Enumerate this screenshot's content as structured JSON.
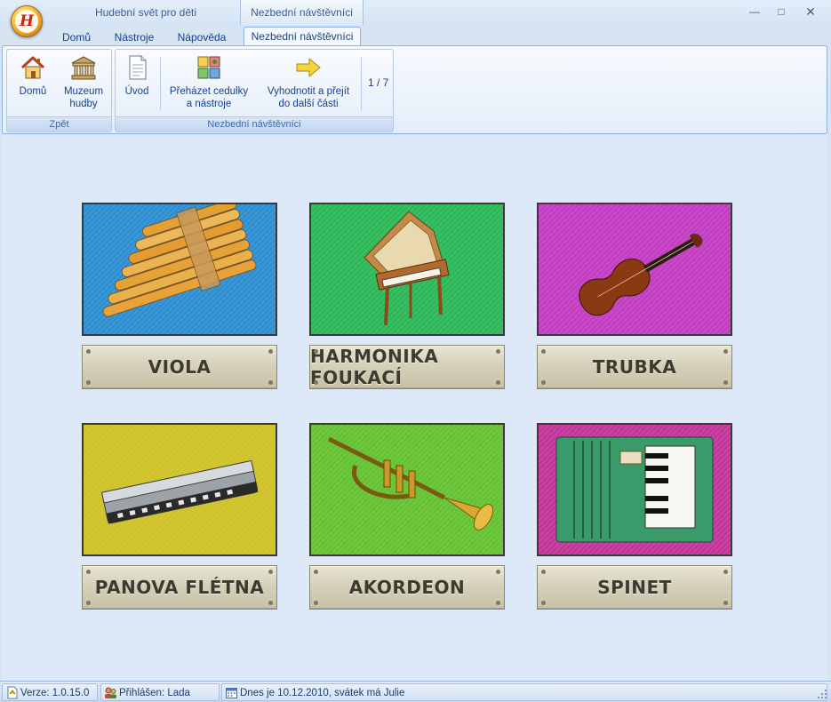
{
  "window": {
    "title_tab": "Hudební svět pro děti",
    "context_tab": "Nezbední návštěvníci",
    "buttons": [
      "minimize",
      "maximize",
      "close"
    ]
  },
  "ribbon_tabs": [
    {
      "label": "Domů"
    },
    {
      "label": "Nástroje"
    },
    {
      "label": "Nápověda"
    },
    {
      "label": "Nezbední návštěvníci",
      "active": true
    }
  ],
  "ribbon": {
    "groups": [
      {
        "caption": "Zpět",
        "buttons": [
          {
            "label": "Domů",
            "icon": "house-icon"
          },
          {
            "label": "Muzeum hudby",
            "line1": "Muzeum",
            "line2": "hudby",
            "icon": "museum-icon"
          }
        ]
      },
      {
        "caption": "Nezbední návštěvníci",
        "buttons": [
          {
            "label": "Úvod",
            "icon": "document-icon"
          },
          {
            "label": "Přeházet cedulky a nástroje",
            "line1": "Přeházet cedulky",
            "line2": "a nástroje",
            "icon": "shuffle-icon"
          },
          {
            "label": "Vyhodnotit a přejít do další části",
            "line1": "Vyhodnotit a přejít",
            "line2": "do další části",
            "icon": "arrow-right-icon"
          }
        ],
        "counter": "1 / 7"
      }
    ]
  },
  "cards": [
    {
      "label": "VIOLA",
      "image": "pan-flute",
      "bg": "#2f8fd0"
    },
    {
      "label": "HARMONIKA FOUKACÍ",
      "image": "spinet",
      "bg": "#2fb85a"
    },
    {
      "label": "TRUBKA",
      "image": "violin",
      "bg": "#c23fc2"
    },
    {
      "label": "PANOVA FLÉTNA",
      "image": "harmonica",
      "bg": "#cfc22a"
    },
    {
      "label": "AKORDEON",
      "image": "trumpet",
      "bg": "#66c234"
    },
    {
      "label": "SPINET",
      "image": "accordion",
      "bg": "#c3379a"
    }
  ],
  "status": {
    "version": "Verze: 1.0.15.0",
    "user": "Přihlášen: Lada",
    "date": "Dnes je 10.12.2010, svátek má Julie"
  }
}
